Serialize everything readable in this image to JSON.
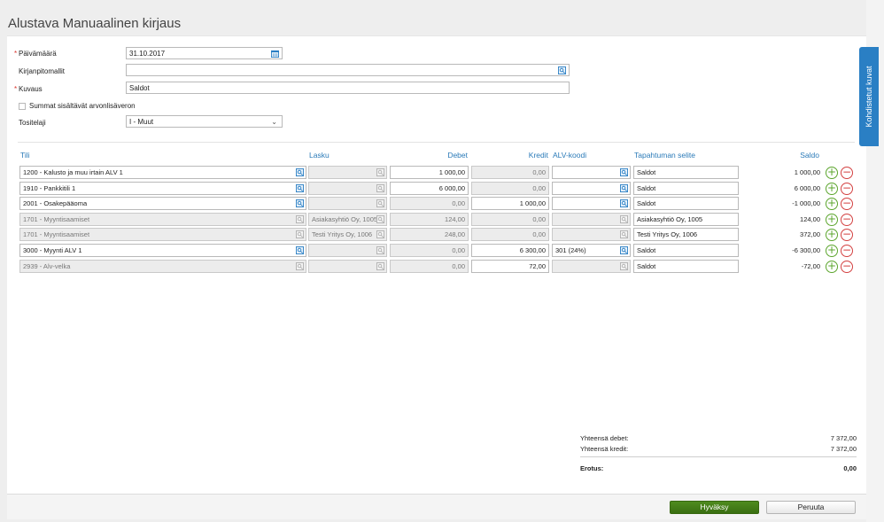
{
  "title": "Alustava Manuaalinen kirjaus",
  "form": {
    "date_label": "Päivämäärä",
    "date_value": "31.10.2017",
    "template_label": "Kirjanpitomallit",
    "template_value": "",
    "desc_label": "Kuvaus",
    "desc_value": "Saldot",
    "vat_checkbox_label": "Summat sisältävät arvonlisäveron",
    "voucher_type_label": "Tositelaji",
    "voucher_type_value": "I - Muut"
  },
  "columns": {
    "account": "Tili",
    "invoice": "Lasku",
    "debit": "Debet",
    "credit": "Kredit",
    "vat_code": "ALV-koodi",
    "description": "Tapahtuman selite",
    "balance": "Saldo"
  },
  "rows": [
    {
      "account": "1200 - Kalusto ja muu irtain ALV 1",
      "invoice": "",
      "debit": "1 000,00",
      "credit": "0,00",
      "vat": "",
      "desc": "Saldot",
      "balance": "1 000,00",
      "account_enabled": true,
      "debit_enabled": true,
      "credit_enabled": false,
      "vat_enabled": true
    },
    {
      "account": "1910 - Pankkitili 1",
      "invoice": "",
      "debit": "6 000,00",
      "credit": "0,00",
      "vat": "",
      "desc": "Saldot",
      "balance": "6 000,00",
      "account_enabled": true,
      "debit_enabled": true,
      "credit_enabled": false,
      "vat_enabled": true
    },
    {
      "account": "2001 - Osakepääoma",
      "invoice": "",
      "debit": "0,00",
      "credit": "1 000,00",
      "vat": "",
      "desc": "Saldot",
      "balance": "-1 000,00",
      "account_enabled": true,
      "debit_enabled": false,
      "credit_enabled": true,
      "vat_enabled": true
    },
    {
      "account": "1701 - Myyntisaamiset",
      "invoice": "Asiakasyhtiö Oy, 1005",
      "debit": "124,00",
      "credit": "0,00",
      "vat": "",
      "desc": "Asiakasyhtiö Oy, 1005",
      "balance": "124,00",
      "account_enabled": false,
      "debit_enabled": false,
      "credit_enabled": false,
      "vat_enabled": false
    },
    {
      "account": "1701 - Myyntisaamiset",
      "invoice": "Testi Yritys Oy, 1006",
      "debit": "248,00",
      "credit": "0,00",
      "vat": "",
      "desc": "Testi Yritys Oy, 1006",
      "balance": "372,00",
      "account_enabled": false,
      "debit_enabled": false,
      "credit_enabled": false,
      "vat_enabled": false
    },
    {
      "account": "3000 - Myynti ALV 1",
      "invoice": "",
      "debit": "0,00",
      "credit": "6 300,00",
      "vat": "301 (24%)",
      "desc": "Saldot",
      "balance": "-6 300,00",
      "account_enabled": true,
      "debit_enabled": false,
      "credit_enabled": true,
      "vat_enabled": true
    },
    {
      "account": "2939 - Alv-velka",
      "invoice": "",
      "debit": "0,00",
      "credit": "72,00",
      "vat": "",
      "desc": "Saldot",
      "balance": "-72,00",
      "account_enabled": false,
      "debit_enabled": false,
      "credit_enabled": true,
      "vat_enabled": false
    }
  ],
  "totals": {
    "debit_label": "Yhteensä debet:",
    "debit_value": "7 372,00",
    "credit_label": "Yhteensä kredit:",
    "credit_value": "7 372,00",
    "diff_label": "Erotus:",
    "diff_value": "0,00"
  },
  "buttons": {
    "approve": "Hyväksy",
    "cancel": "Peruuta"
  },
  "side_tab": "Kohdistetut kuvat",
  "colors": {
    "accent": "#2a7fc4",
    "approve": "#4f8b1f",
    "add": "#5ba52c",
    "remove": "#d34040",
    "required": "#d9342b"
  },
  "icons": {
    "calendar": "calendar-icon",
    "lookup": "lookup-icon",
    "add": "plus-circle-icon",
    "remove": "minus-circle-icon",
    "dropdown": "chevron-down-icon"
  }
}
